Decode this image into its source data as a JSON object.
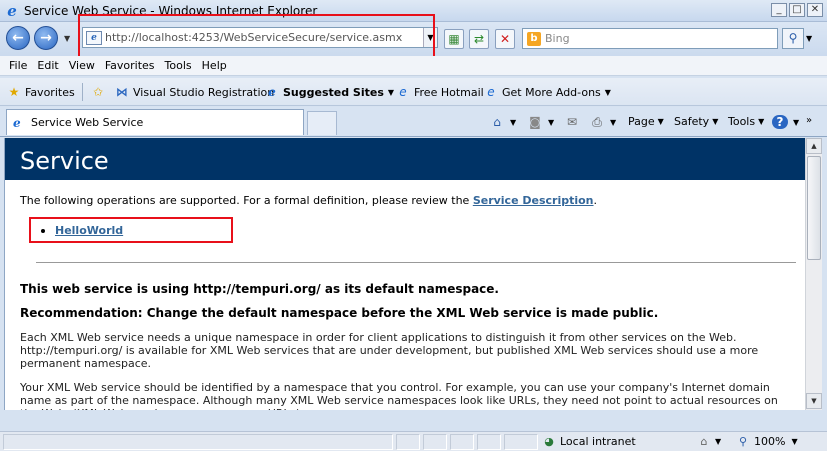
{
  "window": {
    "title": "Service Web Service - Windows Internet Explorer",
    "minimize_glyph": "_",
    "maximize_glyph": "□",
    "close_glyph": "✕"
  },
  "address": {
    "url": "http://localhost:4253/WebServiceSecure/service.asmx",
    "search_placeholder": "Bing"
  },
  "menu": [
    "File",
    "Edit",
    "View",
    "Favorites",
    "Tools",
    "Help"
  ],
  "favorites_bar": {
    "favorites_label": "Favorites",
    "items": [
      "Visual Studio Registration",
      "Suggested Sites",
      "Free Hotmail",
      "Get More Add-ons"
    ]
  },
  "tab": {
    "title": "Service Web Service"
  },
  "commandbar": {
    "page": "Page",
    "safety": "Safety",
    "tools": "Tools"
  },
  "page": {
    "heading": "Service",
    "intro_text": "The following operations are supported. For a formal definition, please review the",
    "service_description_link": "Service Description",
    "intro_end": ".",
    "operations": [
      "HelloWorld"
    ],
    "namespace_notice": "This web service is using http://tempuri.org/ as its default namespace.",
    "recommendation": "Recommendation: Change the default namespace before the XML Web service is made public.",
    "para1": "Each XML Web service needs a unique namespace in order for client applications to distinguish it from other services on the Web. http://tempuri.org/ is available for XML Web services that are under development, but published XML Web services should use a more permanent namespace.",
    "para2": "Your XML Web service should be identified by a namespace that you control. For example, you can use your company's Internet domain name as part of the namespace. Although many XML Web service namespaces look like URLs, they need not point to actual resources on the Web. (XML Web service namespaces are URIs.)"
  },
  "status": {
    "zone": "Local intranet",
    "zoom": "100%"
  },
  "colors": {
    "header_bg": "#003366",
    "link": "#336699",
    "highlight": "#e8101a"
  }
}
